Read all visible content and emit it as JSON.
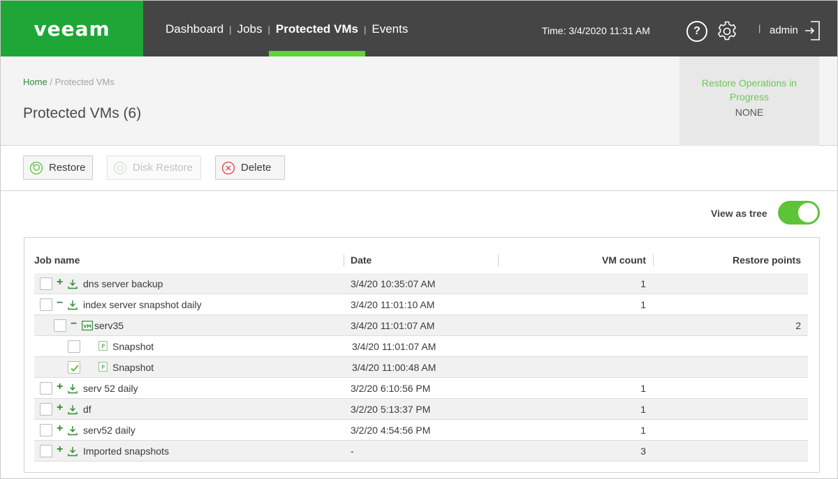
{
  "brand": {
    "logo": "veeam"
  },
  "nav": [
    {
      "label": "Dashboard",
      "active": false
    },
    {
      "label": "Jobs",
      "active": false
    },
    {
      "label": "Protected VMs",
      "active": true
    },
    {
      "label": "Events",
      "active": false
    }
  ],
  "header": {
    "time": "Time: 3/4/2020 11:31 AM",
    "help": "?",
    "user": "admin",
    "icons": [
      "help-icon",
      "gear-icon",
      "logout-icon"
    ]
  },
  "breadcrumb": {
    "home": "Home",
    "sep": "/",
    "current": "Protected VMs"
  },
  "page_title": "Protected VMs (6)",
  "restore_ops": {
    "title": "Restore Operations in Progress",
    "value": "NONE"
  },
  "toolbar": {
    "restore": "Restore",
    "disk_restore": "Disk Restore",
    "delete": "Delete"
  },
  "view_as_tree": {
    "label": "View as tree",
    "enabled": true
  },
  "table": {
    "columns": [
      "Job name",
      "Date",
      "VM count",
      "Restore points"
    ],
    "rows": [
      {
        "level": 0,
        "type": "job",
        "expander": "+",
        "checked": false,
        "name": "dns server backup",
        "date": "3/4/20 10:35:07 AM",
        "vm_count": "1",
        "restore_points": ""
      },
      {
        "level": 0,
        "type": "job",
        "expander": "−",
        "checked": false,
        "name": "index server snapshot daily",
        "date": "3/4/20 11:01:10 AM",
        "vm_count": "1",
        "restore_points": ""
      },
      {
        "level": 1,
        "type": "vm",
        "expander": "−",
        "checked": false,
        "name": "serv35",
        "date": "3/4/20 11:01:07 AM",
        "vm_count": "",
        "restore_points": "2"
      },
      {
        "level": 2,
        "type": "point",
        "expander": "",
        "checked": false,
        "name": "Snapshot",
        "date": "3/4/20 11:01:07 AM",
        "vm_count": "",
        "restore_points": ""
      },
      {
        "level": 2,
        "type": "point",
        "expander": "",
        "checked": true,
        "name": "Snapshot",
        "date": "3/4/20 11:00:48 AM",
        "vm_count": "",
        "restore_points": ""
      },
      {
        "level": 0,
        "type": "job",
        "expander": "+",
        "checked": false,
        "name": "serv 52 daily",
        "date": "3/2/20 6:10:56 PM",
        "vm_count": "1",
        "restore_points": ""
      },
      {
        "level": 0,
        "type": "job",
        "expander": "+",
        "checked": false,
        "name": "df",
        "date": "3/2/20 5:13:37 PM",
        "vm_count": "1",
        "restore_points": ""
      },
      {
        "level": 0,
        "type": "job",
        "expander": "+",
        "checked": false,
        "name": "serv52 daily",
        "date": "3/2/20 4:54:56 PM",
        "vm_count": "1",
        "restore_points": ""
      },
      {
        "level": 0,
        "type": "job",
        "expander": "+",
        "checked": false,
        "name": "Imported snapshots",
        "date": "-",
        "vm_count": "3",
        "restore_points": ""
      }
    ]
  },
  "colors": {
    "brand_green": "#1ea637",
    "accent_green": "#5fd33a",
    "header_bg": "#454545",
    "link_green": "#2d8a34"
  }
}
